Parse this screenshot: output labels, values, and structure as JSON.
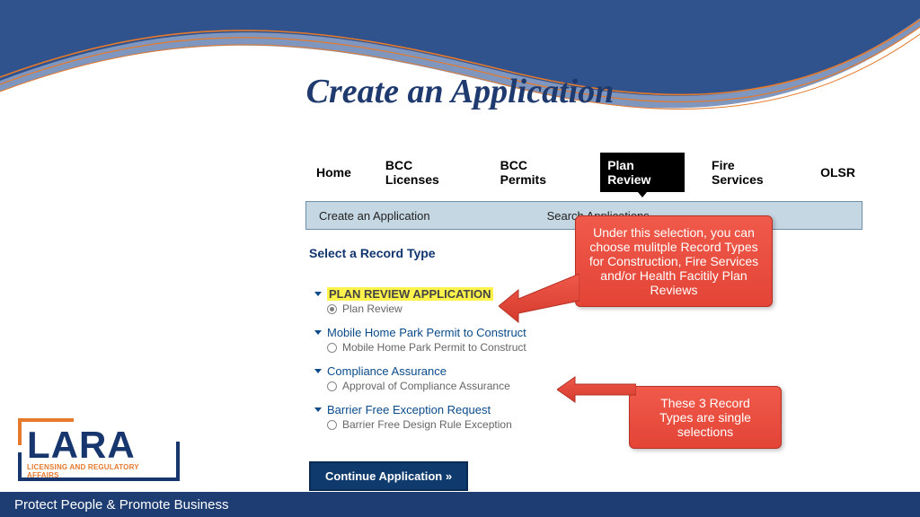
{
  "slide_title": "Create an Application",
  "tabs": [
    "Home",
    "BCC Licenses",
    "BCC Permits",
    "Plan Review",
    "Fire Services",
    "OLSR"
  ],
  "active_tab_index": 3,
  "subbar": {
    "create": "Create an Application",
    "search": "Search Applications"
  },
  "section_header": "Select a Record Type",
  "record_groups": [
    {
      "head": "PLAN REVIEW APPLICATION",
      "highlight": true,
      "options": [
        {
          "label": "Plan Review",
          "selected": true
        }
      ]
    },
    {
      "head": "Mobile Home Park Permit to Construct",
      "highlight": false,
      "options": [
        {
          "label": "Mobile Home Park Permit to Construct",
          "selected": false
        }
      ]
    },
    {
      "head": "Compliance Assurance",
      "highlight": false,
      "options": [
        {
          "label": "Approval of Compliance Assurance",
          "selected": false
        }
      ]
    },
    {
      "head": "Barrier Free Exception Request",
      "highlight": false,
      "options": [
        {
          "label": "Barrier Free Design Rule Exception",
          "selected": false
        }
      ]
    }
  ],
  "continue_label": "Continue Application »",
  "callouts": {
    "c1": "Under this selection, you can choose mulitple Record Types for Construction, Fire Services and/or Health Facitily Plan Reviews",
    "c2": "These 3 Record Types are single selections"
  },
  "logo": {
    "text": "LARA",
    "sub": "LICENSING AND REGULATORY AFFAIRS"
  },
  "footer": "Protect People & Promote Business"
}
